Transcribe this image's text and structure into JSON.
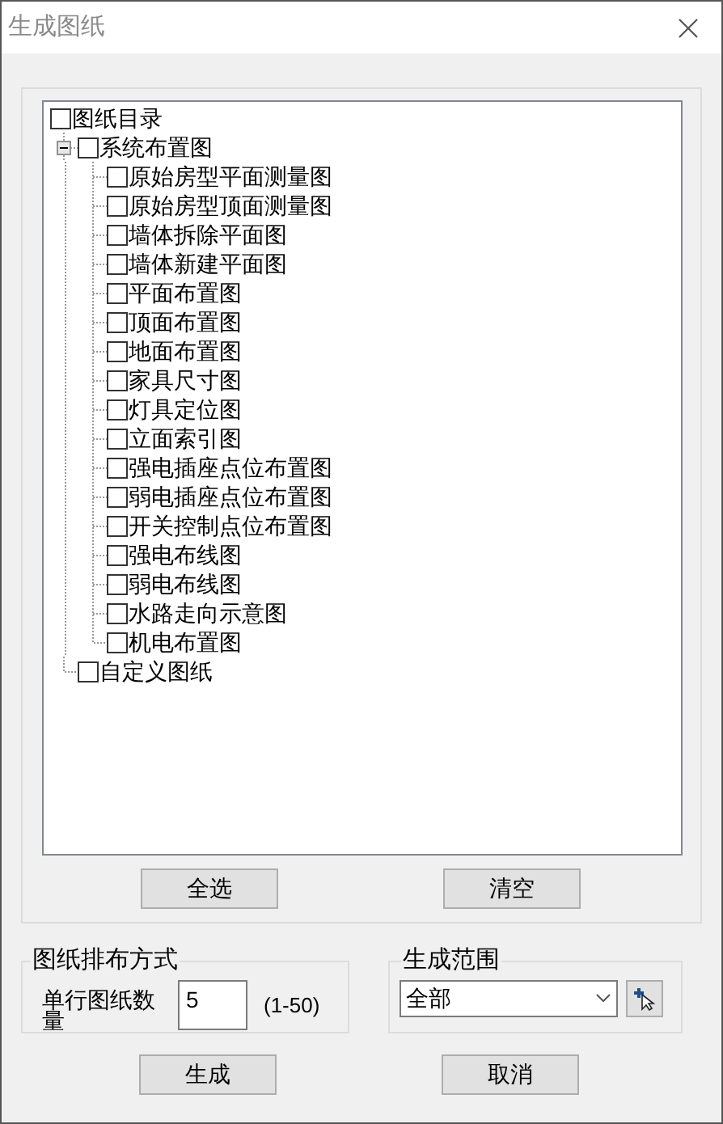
{
  "window": {
    "title": "生成图纸"
  },
  "tree": {
    "label": "图纸目录",
    "checked": false,
    "children": [
      {
        "label": "系统布置图",
        "checked": false,
        "expanded": true,
        "children": [
          {
            "label": "原始房型平面测量图",
            "checked": false
          },
          {
            "label": "原始房型顶面测量图",
            "checked": false
          },
          {
            "label": "墙体拆除平面图",
            "checked": false
          },
          {
            "label": "墙体新建平面图",
            "checked": false
          },
          {
            "label": "平面布置图",
            "checked": false
          },
          {
            "label": "顶面布置图",
            "checked": false
          },
          {
            "label": "地面布置图",
            "checked": false
          },
          {
            "label": "家具尺寸图",
            "checked": false
          },
          {
            "label": "灯具定位图",
            "checked": false
          },
          {
            "label": "立面索引图",
            "checked": false
          },
          {
            "label": "强电插座点位布置图",
            "checked": false
          },
          {
            "label": "弱电插座点位布置图",
            "checked": false
          },
          {
            "label": "开关控制点位布置图",
            "checked": false
          },
          {
            "label": "强电布线图",
            "checked": false
          },
          {
            "label": "弱电布线图",
            "checked": false
          },
          {
            "label": "水路走向示意图",
            "checked": false
          },
          {
            "label": "机电布置图",
            "checked": false
          }
        ]
      },
      {
        "label": "自定义图纸",
        "checked": false
      }
    ]
  },
  "tree_buttons": [
    "全选",
    "清空"
  ],
  "layout_group": {
    "title": "图纸排布方式",
    "field_label": "单行图纸数量",
    "value": "5",
    "range": "(1-50)"
  },
  "scope_group": {
    "title": "生成范围",
    "value": "全部"
  },
  "buttons": [
    "生成",
    "取消"
  ]
}
